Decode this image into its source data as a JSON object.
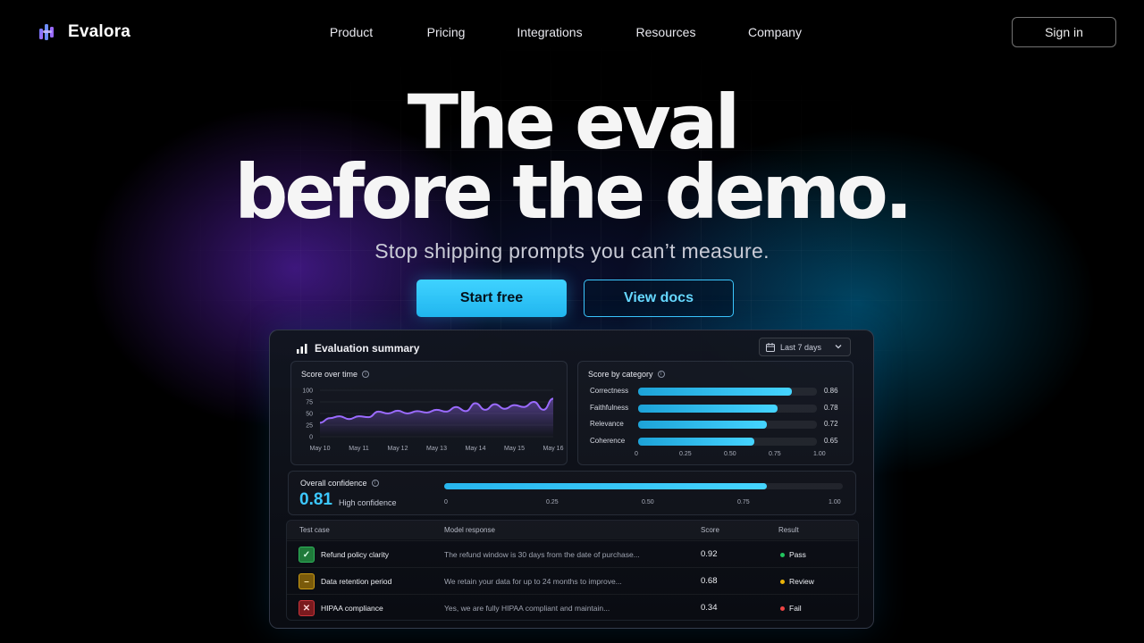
{
  "brand": {
    "name": "Evalora"
  },
  "nav": {
    "links": [
      "Product",
      "Pricing",
      "Integrations",
      "Resources",
      "Company"
    ],
    "sign_in": "Sign in"
  },
  "hero": {
    "headline_line1": "The eval",
    "headline_line2": "before the demo.",
    "subheadline": "Stop shipping prompts you can’t measure.",
    "primary_cta": "Start free",
    "secondary_cta": "View docs"
  },
  "dashboard": {
    "title": "Evaluation summary",
    "range": "Last 7 days",
    "score_over_time": {
      "title": "Score over time"
    },
    "score_by_category": {
      "title": "Score by category"
    },
    "confidence": {
      "title": "Overall confidence",
      "value": "0.81",
      "label": "High confidence",
      "fraction": 0.81,
      "ticks": [
        "0",
        "0.25",
        "0.50",
        "0.75",
        "1.00"
      ]
    },
    "table": {
      "headers": [
        "Test case",
        "Model response",
        "Score",
        "Result"
      ],
      "rows": [
        {
          "case": "Refund policy clarity",
          "response": "The refund window is 30 days from the date of purchase...",
          "score": "0.92",
          "result": "Pass",
          "status": "pass"
        },
        {
          "case": "Data retention period",
          "response": "We retain your data for up to 24 months to improve...",
          "score": "0.68",
          "result": "Review",
          "status": "review"
        },
        {
          "case": "HIPAA compliance",
          "response": "Yes, we are fully HIPAA compliant and maintain...",
          "score": "0.34",
          "result": "Fail",
          "status": "fail"
        }
      ]
    }
  },
  "colors": {
    "accent": "#3cc8ff",
    "line": "#9b6bff",
    "pass": "#22c55e",
    "review": "#eab308",
    "fail": "#ef4444"
  },
  "icons": {
    "logo": "logo-mark-icon",
    "dashboard": "bar-chart-icon",
    "calendar": "calendar-icon",
    "chevron": "chevron-down-icon",
    "info": "info-icon",
    "pass": "check-icon",
    "review": "minus-icon",
    "fail": "x-icon"
  },
  "chart_data": [
    {
      "type": "area",
      "title": "Score over time",
      "x": [
        "May 10",
        "May 11",
        "May 12",
        "May 13",
        "May 14",
        "May 15",
        "May 16"
      ],
      "xvalues": [
        0,
        0.25,
        0.5,
        0.75,
        1,
        1.25,
        1.5,
        1.75,
        2,
        2.25,
        2.5,
        2.75,
        3,
        3.25,
        3.5,
        3.75,
        4,
        4.25,
        4.5,
        4.75,
        5,
        5.25,
        5.5,
        5.75,
        6
      ],
      "values": [
        30,
        40,
        44,
        38,
        44,
        42,
        54,
        50,
        56,
        50,
        55,
        52,
        58,
        54,
        64,
        55,
        72,
        58,
        70,
        60,
        68,
        64,
        75,
        58,
        82
      ],
      "ylim": [
        0,
        100
      ],
      "yticks": [
        0,
        25,
        50,
        75,
        100
      ],
      "xlabel": "",
      "ylabel": ""
    },
    {
      "type": "bar",
      "title": "Score by category",
      "orientation": "horizontal",
      "categories": [
        "Correctness",
        "Faithfulness",
        "Relevance",
        "Coherence"
      ],
      "values": [
        0.86,
        0.78,
        0.72,
        0.65
      ],
      "xlim": [
        0,
        1
      ],
      "xticks": [
        "0",
        "0.25",
        "0.50",
        "0.75",
        "1.00"
      ]
    }
  ]
}
